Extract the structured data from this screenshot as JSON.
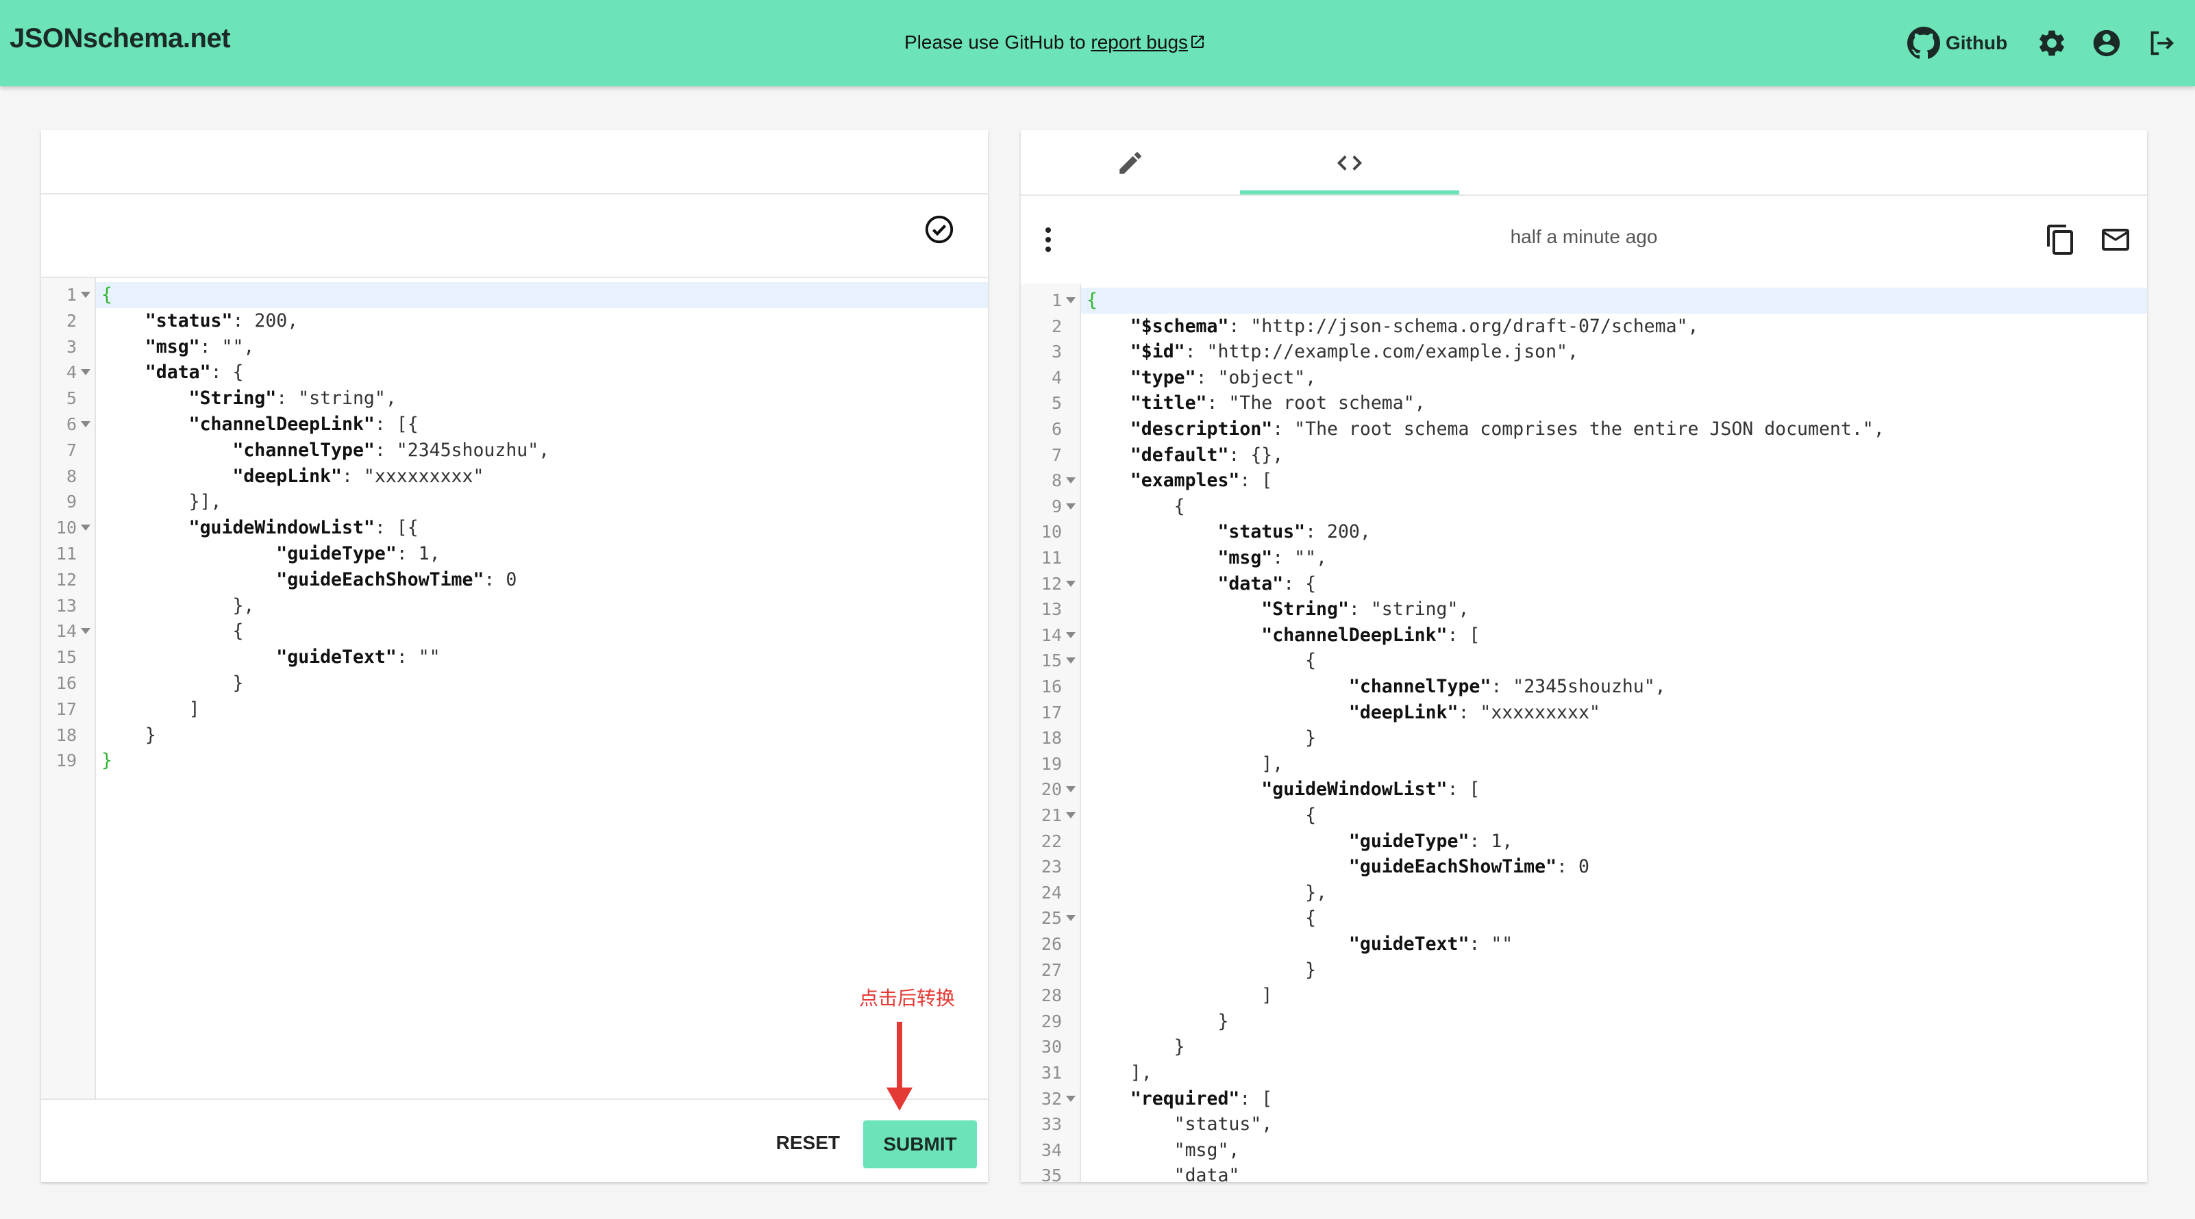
{
  "header": {
    "logo": "JSONschema.net",
    "notice_prefix": "Please use GitHub to ",
    "notice_link": "report bugs",
    "github_label": "Github"
  },
  "left_panel": {
    "code_lines": [
      "{",
      "    \"status\": 200,",
      "    \"msg\": \"\",",
      "    \"data\": {",
      "        \"String\": \"string\",",
      "        \"channelDeepLink\": [{",
      "            \"channelType\": \"2345shouzhu\",",
      "            \"deepLink\": \"xxxxxxxxx\"",
      "        }],",
      "        \"guideWindowList\": [{",
      "                \"guideType\": 1,",
      "                \"guideEachShowTime\": 0",
      "            },",
      "            {",
      "                \"guideText\": \"\"",
      "            }",
      "        ]",
      "    }",
      "}"
    ],
    "folds": [
      1,
      4,
      6,
      10,
      14
    ],
    "reset_label": "RESET",
    "submit_label": "SUBMIT",
    "annotation": "点击后转换"
  },
  "right_panel": {
    "time_ago": "half a minute ago",
    "code_lines": [
      "{",
      "    \"$schema\": \"http://json-schema.org/draft-07/schema\",",
      "    \"$id\": \"http://example.com/example.json\",",
      "    \"type\": \"object\",",
      "    \"title\": \"The root schema\",",
      "    \"description\": \"The root schema comprises the entire JSON document.\",",
      "    \"default\": {},",
      "    \"examples\": [",
      "        {",
      "            \"status\": 200,",
      "            \"msg\": \"\",",
      "            \"data\": {",
      "                \"String\": \"string\",",
      "                \"channelDeepLink\": [",
      "                    {",
      "                        \"channelType\": \"2345shouzhu\",",
      "                        \"deepLink\": \"xxxxxxxxx\"",
      "                    }",
      "                ],",
      "                \"guideWindowList\": [",
      "                    {",
      "                        \"guideType\": 1,",
      "                        \"guideEachShowTime\": 0",
      "                    },",
      "                    {",
      "                        \"guideText\": \"\"",
      "                    }",
      "                ]",
      "            }",
      "        }",
      "    ],",
      "    \"required\": [",
      "        \"status\",",
      "        \"msg\",",
      "        \"data\""
    ],
    "folds": [
      1,
      8,
      9,
      12,
      14,
      15,
      20,
      21,
      25,
      32
    ]
  },
  "colors": {
    "accent": "#6de4b8",
    "annotation": "#e53935",
    "brace": "#2fb52f"
  },
  "icons": [
    "github-icon",
    "gear-icon",
    "account-icon",
    "logout-icon",
    "check-circle-icon",
    "edit-icon",
    "code-icon",
    "more-vert-icon",
    "copy-icon",
    "mail-icon",
    "external-link-icon"
  ]
}
